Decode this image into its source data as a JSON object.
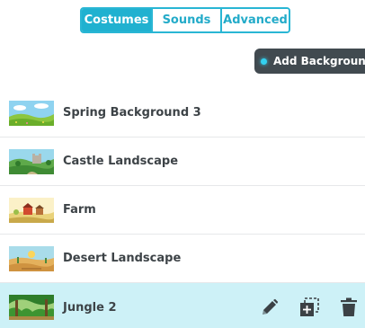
{
  "tabs": [
    {
      "label": "Costumes",
      "active": true
    },
    {
      "label": "Sounds",
      "active": false
    },
    {
      "label": "Advanced",
      "active": false
    }
  ],
  "add_background": {
    "label": "Add Background",
    "icon": "plus-dot-icon"
  },
  "backgrounds": [
    {
      "name": "Spring Background 3",
      "thumbnail": "spring-meadow",
      "selected": false
    },
    {
      "name": "Castle Landscape",
      "thumbnail": "castle-landscape",
      "selected": false
    },
    {
      "name": "Farm",
      "thumbnail": "farm",
      "selected": false
    },
    {
      "name": "Desert Landscape",
      "thumbnail": "desert",
      "selected": false
    },
    {
      "name": "Jungle 2",
      "thumbnail": "jungle",
      "selected": true
    }
  ],
  "row_actions": {
    "edit_icon": "pencil-icon",
    "duplicate_icon": "duplicate-icon",
    "delete_icon": "trash-icon"
  },
  "colors": {
    "accent": "#20b1d0",
    "selected_row": "#cdf1f7",
    "dark_button": "#414a50",
    "text": "#3d4347"
  }
}
